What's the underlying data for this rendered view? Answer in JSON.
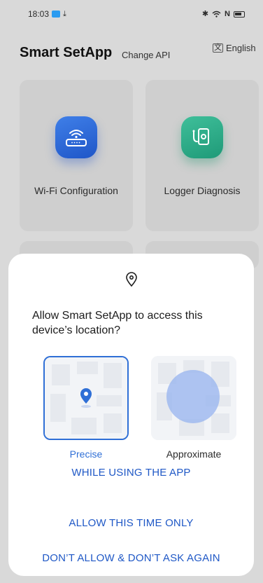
{
  "status_bar": {
    "time": "18:03",
    "icons": [
      "app-notification-icon",
      "download-icon",
      "bluetooth-icon",
      "wifi-icon",
      "nfc-icon",
      "battery-icon"
    ]
  },
  "header": {
    "title": "Smart SetApp",
    "change_api": "Change API",
    "language": "English"
  },
  "cards": [
    {
      "label": "Wi-Fi Configuration",
      "icon": "router-icon",
      "color": "#2f6fd6"
    },
    {
      "label": "Logger Diagnosis",
      "icon": "logger-icon",
      "color": "#2aa886"
    }
  ],
  "permission_dialog": {
    "title": "Allow Smart SetApp to access this device’s location?",
    "options": [
      {
        "label": "Precise",
        "selected": true
      },
      {
        "label": "Approximate",
        "selected": false
      }
    ],
    "actions": {
      "while_using": "WHILE USING THE APP",
      "this_time": "ALLOW THIS TIME ONLY",
      "dont_allow": "DON’T ALLOW & DON’T ASK AGAIN"
    },
    "accent_color": "#2f6fd6"
  }
}
